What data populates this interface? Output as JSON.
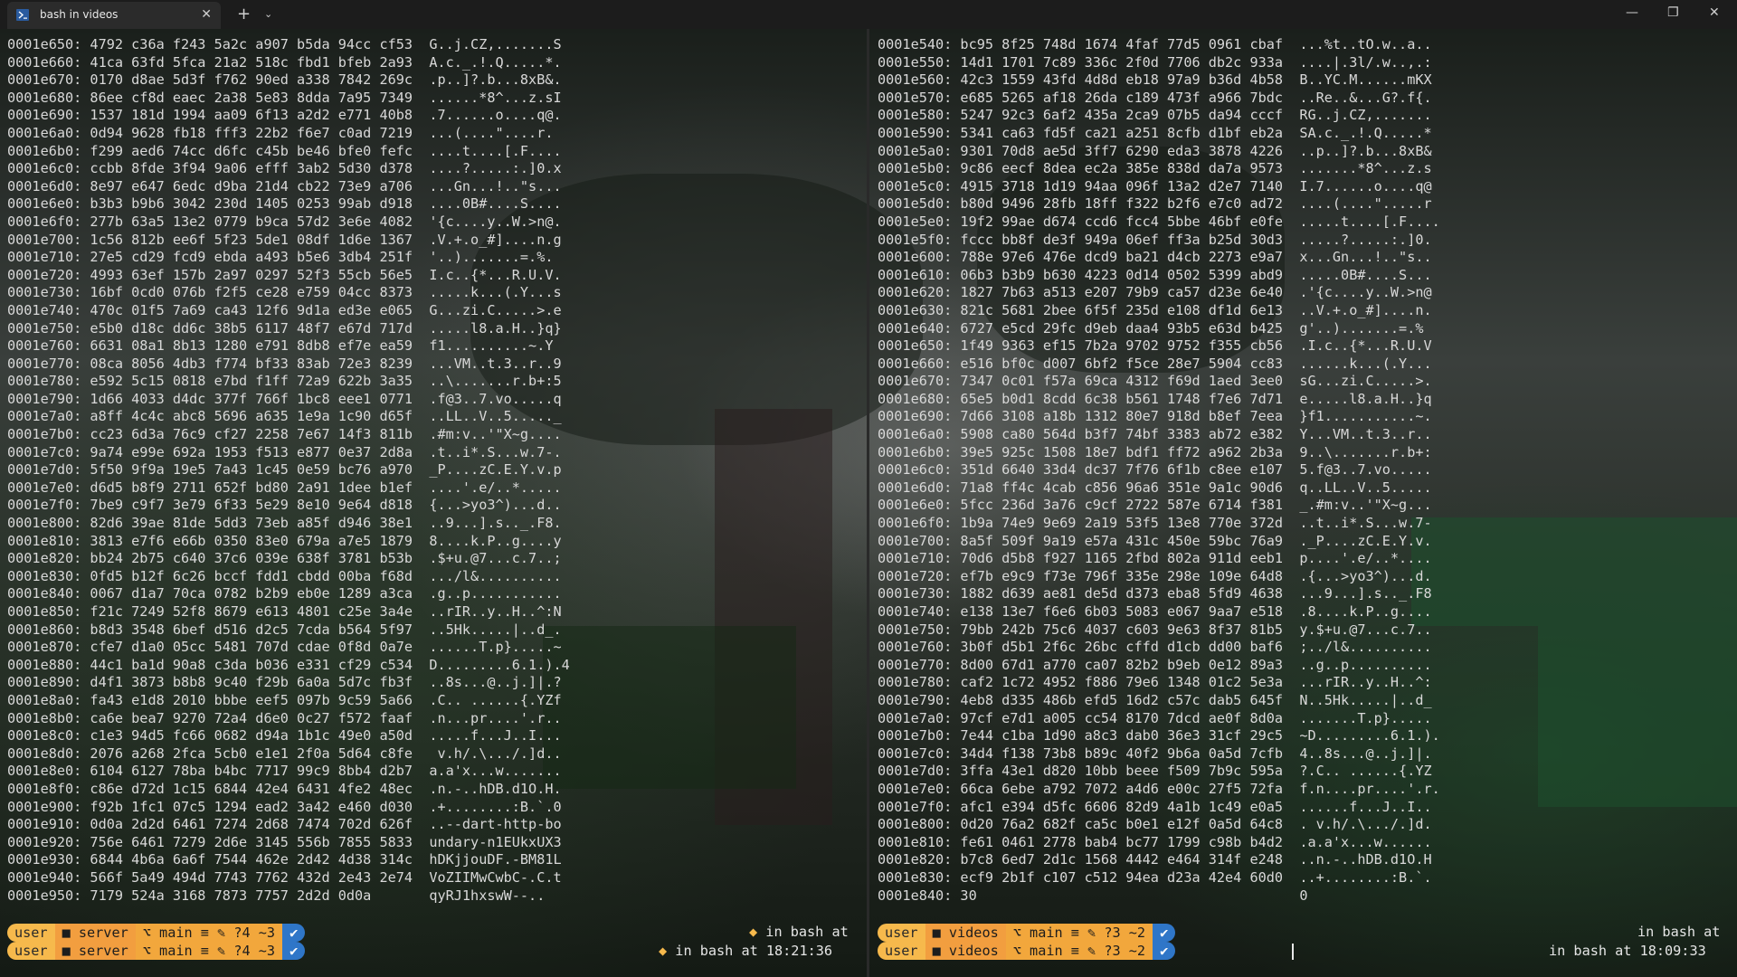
{
  "titlebar": {
    "tab_title": "bash in videos",
    "tab_close": "✕",
    "new_tab": "+",
    "dropdown": "⌄",
    "minimize": "—",
    "maximize": "❐",
    "close": "✕"
  },
  "left_pane": {
    "lines": [
      "0001e650: 4792 c36a f243 5a2c a907 b5da 94cc cf53  G..j.CZ,.......S",
      "0001e660: 41ca 63fd 5fca 21a2 518c fbd1 bfeb 2a93  A.c._.!.Q.....*.",
      "0001e670: 0170 d8ae 5d3f f762 90ed a338 7842 269c  .p..]?.b...8xB&.",
      "0001e680: 86ee cf8d eaec 2a38 5e83 8dda 7a95 7349  ......*8^...z.sI",
      "0001e690: 1537 181d 1994 aa09 6f13 a2d2 e771 40b8  .7......o....q@.",
      "0001e6a0: 0d94 9628 fb18 fff3 22b2 f6e7 c0ad 7219  ...(....\"....r.",
      "0001e6b0: f299 aed6 74cc d6fc c45b be46 bfe0 fefc  ....t....[.F....",
      "0001e6c0: ccbb 8fde 3f94 9a06 efff 3ab2 5d30 d378  ....?.....:.]0.x",
      "0001e6d0: 8e97 e647 6edc d9ba 21d4 cb22 73e9 a706  ...Gn...!..\"s...",
      "0001e6e0: b3b3 b9b6 3042 230d 1405 0253 99ab d918  ....0B#....S....",
      "0001e6f0: 277b 63a5 13e2 0779 b9ca 57d2 3e6e 4082  '{c....y..W.>n@.",
      "0001e700: 1c56 812b ee6f 5f23 5de1 08df 1d6e 1367  .V.+.o_#]....n.g",
      "0001e710: 27e5 cd29 fcd9 ebda a493 b5e6 3db4 251f  '..).......=.%.",
      "0001e720: 4993 63ef 157b 2a97 0297 52f3 55cb 56e5  I.c..{*...R.U.V.",
      "0001e730: 16bf 0cd0 076b f2f5 ce28 e759 04cc 8373  .....k...(.Y...s",
      "0001e740: 470c 01f5 7a69 ca43 12f6 9d1a ed3e e065  G...zi.C.....>.e",
      "0001e750: e5b0 d18c dd6c 38b5 6117 48f7 e67d 717d  .....l8.a.H..}q}",
      "0001e760: 6631 08a1 8b13 1280 e791 8db8 ef7e ea59  f1..........~.Y",
      "0001e770: 08ca 8056 4db3 f774 bf33 83ab 72e3 8239  ...VM..t.3..r..9",
      "0001e780: e592 5c15 0818 e7bd f1ff 72a9 622b 3a35  ..\\.......r.b+:5",
      "0001e790: 1d66 4033 d4dc 377f 766f 1bc8 eee1 0771  .f@3..7.vo.....q",
      "0001e7a0: a8ff 4c4c abc8 5696 a635 1e9a 1c90 d65f  ..LL..V..5....._",
      "0001e7b0: cc23 6d3a 76c9 cf27 2258 7e67 14f3 811b  .#m:v..'\"X~g....",
      "0001e7c0: 9a74 e99e 692a 1953 f513 e877 0e37 2d8a  .t..i*.S...w.7-.",
      "0001e7d0: 5f50 9f9a 19e5 7a43 1c45 0e59 bc76 a970  _P....zC.E.Y.v.p",
      "0001e7e0: d6d5 b8f9 2711 652f bd80 2a91 1dee b1ef  ....'.e/..*.....",
      "0001e7f0: 7be9 c9f7 3e79 6f33 5e29 8e10 9e64 d818  {...>yo3^)...d..",
      "0001e800: 82d6 39ae 81de 5dd3 73eb a85f d946 38e1  ..9...].s.._.F8.",
      "0001e810: 3813 e7f6 e66b 0350 83e0 679a a7e5 1879  8....k.P..g....y",
      "0001e820: bb24 2b75 c640 37c6 039e 638f 3781 b53b  .$+u.@7...c.7..;",
      "0001e830: 0fd5 b12f 6c26 bccf fdd1 cbdd 00ba f68d  .../l&..........",
      "0001e840: 0067 d1a7 70ca 0782 b2b9 eb0e 1289 a3ca  .g..p...........",
      "0001e850: f21c 7249 52f8 8679 e613 4801 c25e 3a4e  ..rIR..y..H..^:N",
      "0001e860: b8d3 3548 6bef d516 d2c5 7cda b564 5f97  ..5Hk.....|..d_.",
      "0001e870: cfe7 d1a0 05cc 5481 707d cdae 0f8d 0a7e  ......T.p}.....~",
      "0001e880: 44c1 ba1d 90a8 c3da b036 e331 cf29 c534  D.........6.1.).4",
      "0001e890: d4f1 3873 b8b8 9c40 f29b 6a0a 5d7c fb3f  ..8s...@..j.]|.?",
      "0001e8a0: fa43 e1d8 2010 bbbe eef5 097b 9c59 5a66  .C.. ......{.YZf",
      "0001e8b0: ca6e bea7 9270 72a4 d6e0 0c27 f572 faaf  .n...pr....'.r..",
      "0001e8c0: c1e3 94d5 fc66 0682 d94a 1b1c 49e0 a50d  .....f...J..I...",
      "0001e8d0: 2076 a268 2fca 5cb0 e1e1 2f0a 5d64 c8fe   v.h/.\\.../.]d..",
      "0001e8e0: 6104 6127 78ba b4bc 7717 99c9 8bb4 d2b7  a.a'x...w.......",
      "0001e8f0: c86e d72d 1c15 6844 42e4 6431 4fe2 48ec  .n.-..hDB.d1O.H.",
      "0001e900: f92b 1fc1 07c5 1294 ead2 3a42 e460 d030  .+........:B.`.0",
      "0001e910: 0d0a 2d2d 6461 7274 2d68 7474 702d 626f  ..--dart-http-bo",
      "0001e920: 756e 6461 7279 2d6e 3145 556b 7855 5833  undary-n1EUkxUX3",
      "0001e930: 6844 4b6a 6a6f 7544 462e 2d42 4d38 314c  hDKjjouDF.-BM81L",
      "0001e940: 566f 5a49 494d 7743 7762 432d 2e43 2e74  VoZIIMwCwbC-.C.t",
      "0001e950: 7179 524a 3168 7873 7757 2d2d 0d0a       qyRJ1hxswW--.."
    ],
    "right_line1": "in bash at",
    "right_line2": "in bash at 18:21:36",
    "prompt": {
      "user": "user",
      "dir": "server",
      "git": "main ≡ ✎ ?4 ~3",
      "ok": "✔"
    }
  },
  "right_pane": {
    "lines": [
      "0001e540: bc95 8f25 748d 1674 4faf 77d5 0961 cbaf  ...%t..tO.w..a..",
      "0001e550: 14d1 1701 7c89 336c 2f0d 7706 db2c 933a  ....|.3l/.w..,.:",
      "0001e560: 42c3 1559 43fd 4d8d eb18 97a9 b36d 4b58  B..YC.M......mKX",
      "0001e570: e685 5265 af18 26da c189 473f a966 7bdc  ..Re..&...G?.f{.",
      "0001e580: 5247 92c3 6af2 435a 2ca9 07b5 da94 cccf  RG..j.CZ,.......",
      "0001e590: 5341 ca63 fd5f ca21 a251 8cfb d1bf eb2a  SA.c._.!.Q.....*",
      "0001e5a0: 9301 70d8 ae5d 3ff7 6290 eda3 3878 4226  ..p..]?.b...8xB&",
      "0001e5b0: 9c86 eecf 8dea ec2a 385e 838d da7a 9573  .......*8^...z.s",
      "0001e5c0: 4915 3718 1d19 94aa 096f 13a2 d2e7 7140  I.7......o....q@",
      "0001e5d0: b80d 9496 28fb 18ff f322 b2f6 e7c0 ad72  ....(....\".....r",
      "0001e5e0: 19f2 99ae d674 ccd6 fcc4 5bbe 46bf e0fe  .....t....[.F....",
      "0001e5f0: fccc bb8f de3f 949a 06ef ff3a b25d 30d3  .....?.....:.]0.",
      "0001e600: 788e 97e6 476e dcd9 ba21 d4cb 2273 e9a7  x...Gn...!..\"s..",
      "0001e610: 06b3 b3b9 b630 4223 0d14 0502 5399 abd9  .....0B#....S...",
      "0001e620: 1827 7b63 a513 e207 79b9 ca57 d23e 6e40  .'{c....y..W.>n@",
      "0001e630: 821c 5681 2bee 6f5f 235d e108 df1d 6e13  ..V.+.o_#]....n.",
      "0001e640: 6727 e5cd 29fc d9eb daa4 93b5 e63d b425  g'..).......=.%",
      "0001e650: 1f49 9363 ef15 7b2a 9702 9752 f355 cb56  .I.c..{*...R.U.V",
      "0001e660: e516 bf0c d007 6bf2 f5ce 28e7 5904 cc83  ......k...(.Y...",
      "0001e670: 7347 0c01 f57a 69ca 4312 f69d 1aed 3ee0  sG...zi.C.....>.",
      "0001e680: 65e5 b0d1 8cdd 6c38 b561 1748 f7e6 7d71  e.....l8.a.H..}q",
      "0001e690: 7d66 3108 a18b 1312 80e7 918d b8ef 7eea  }f1...........~.",
      "0001e6a0: 5908 ca80 564d b3f7 74bf 3383 ab72 e382  Y...VM..t.3..r..",
      "0001e6b0: 39e5 925c 1508 18e7 bdf1 ff72 a962 2b3a  9..\\.......r.b+:",
      "0001e6c0: 351d 6640 33d4 dc37 7f76 6f1b c8ee e107  5.f@3..7.vo.....",
      "0001e6d0: 71a8 ff4c 4cab c856 96a6 351e 9a1c 90d6  q..LL..V..5.....",
      "0001e6e0: 5fcc 236d 3a76 c9cf 2722 587e 6714 f381  _.#m:v..'\"X~g...",
      "0001e6f0: 1b9a 74e9 9e69 2a19 53f5 13e8 770e 372d  ..t..i*.S...w.7-",
      "0001e700: 8a5f 509f 9a19 e57a 431c 450e 59bc 76a9  ._P....zC.E.Y.v.",
      "0001e710: 70d6 d5b8 f927 1165 2fbd 802a 911d eeb1  p....'.e/..*....",
      "0001e720: ef7b e9c9 f73e 796f 335e 298e 109e 64d8  .{...>yo3^)...d.",
      "0001e730: 1882 d639 ae81 de5d d373 eba8 5fd9 4638  ...9...].s.._.F8",
      "0001e740: e138 13e7 f6e6 6b03 5083 e067 9aa7 e518  .8....k.P..g....",
      "0001e750: 79bb 242b 75c6 4037 c603 9e63 8f37 81b5  y.$+u.@7...c.7..",
      "0001e760: 3b0f d5b1 2f6c 26bc cffd d1cb dd00 baf6  ;../l&..........",
      "0001e770: 8d00 67d1 a770 ca07 82b2 b9eb 0e12 89a3  ..g..p..........",
      "0001e780: caf2 1c72 4952 f886 79e6 1348 01c2 5e3a  ...rIR..y..H..^:",
      "0001e790: 4eb8 d335 486b efd5 16d2 c57c dab5 645f  N..5Hk.....|..d_",
      "0001e7a0: 97cf e7d1 a005 cc54 8170 7dcd ae0f 8d0a  .......T.p}.....",
      "0001e7b0: 7e44 c1ba 1d90 a8c3 dab0 36e3 31cf 29c5  ~D.........6.1.).",
      "0001e7c0: 34d4 f138 73b8 b89c 40f2 9b6a 0a5d 7cfb  4..8s...@..j.]|.",
      "0001e7d0: 3ffa 43e1 d820 10bb beee f509 7b9c 595a  ?.C.. ......{.YZ",
      "0001e7e0: 66ca 6ebe a792 7072 a4d6 e00c 27f5 72fa  f.n....pr....'.r.",
      "0001e7f0: afc1 e394 d5fc 6606 82d9 4a1b 1c49 e0a5  ......f...J..I..",
      "0001e800: 0d20 76a2 682f ca5c b0e1 e12f 0a5d 64c8  . v.h/.\\.../.]d.",
      "0001e810: fe61 0461 2778 bab4 bc77 1799 c98b b4d2  .a.a'x...w......",
      "0001e820: b7c8 6ed7 2d1c 1568 4442 e464 314f e248  ..n.-..hDB.d1O.H",
      "0001e830: ecf9 2b1f c107 c512 94ea d23a 42e4 60d0  ..+........:B.`.",
      "0001e840: 30                                       0"
    ],
    "right_line1": "in bash at",
    "right_line2": "in bash at 18:09:33",
    "prompt": {
      "user": "user",
      "dir": "videos",
      "git": "main ≡ ✎ ?3 ~2",
      "ok": "✔"
    }
  }
}
